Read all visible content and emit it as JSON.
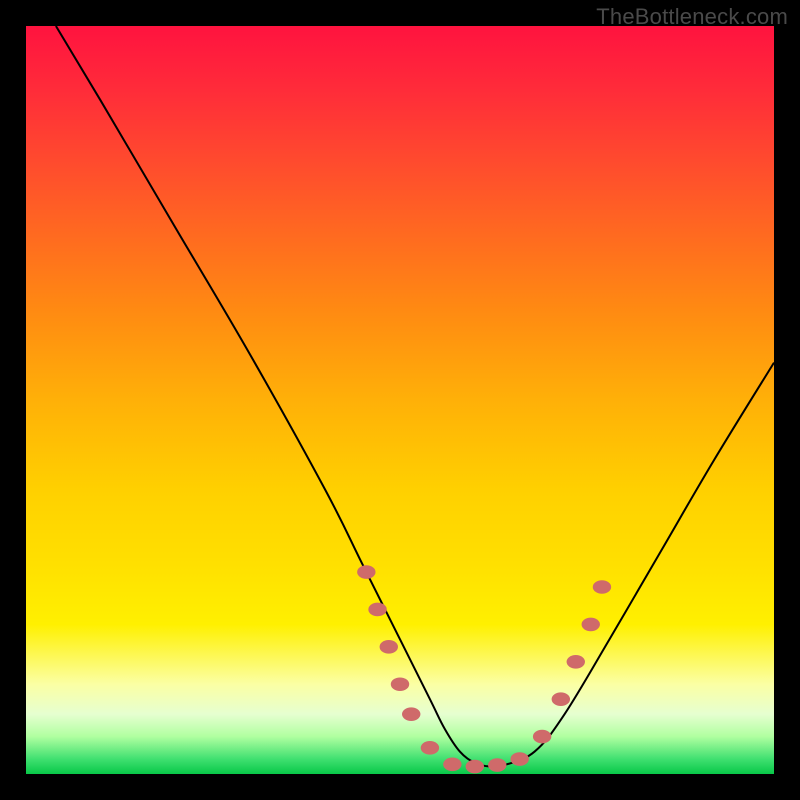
{
  "watermark": "TheBottleneck.com",
  "chart_data": {
    "type": "line",
    "title": "",
    "xlabel": "",
    "ylabel": "",
    "xlim": [
      0,
      100
    ],
    "ylim": [
      0,
      100
    ],
    "grid": false,
    "legend": false,
    "series": [
      {
        "name": "curve",
        "x": [
          4,
          10,
          20,
          30,
          40,
          45,
          50,
          54,
          56,
          58,
          60,
          62,
          64,
          68,
          72,
          78,
          85,
          92,
          100
        ],
        "y": [
          100,
          90,
          73,
          56,
          38,
          28,
          18,
          10,
          6,
          3,
          1.5,
          1,
          1.2,
          3,
          8,
          18,
          30,
          42,
          55
        ],
        "stroke": "#000000",
        "stroke_width": 2
      }
    ],
    "markers": [
      {
        "name": "highlight-dots",
        "color": "#cf6a6a",
        "radius": 8,
        "points": [
          {
            "x": 45.5,
            "y": 27
          },
          {
            "x": 47.0,
            "y": 22
          },
          {
            "x": 48.5,
            "y": 17
          },
          {
            "x": 50.0,
            "y": 12
          },
          {
            "x": 51.5,
            "y": 8
          },
          {
            "x": 54.0,
            "y": 3.5
          },
          {
            "x": 57.0,
            "y": 1.3
          },
          {
            "x": 60.0,
            "y": 1.0
          },
          {
            "x": 63.0,
            "y": 1.2
          },
          {
            "x": 66.0,
            "y": 2.0
          },
          {
            "x": 69.0,
            "y": 5.0
          },
          {
            "x": 71.5,
            "y": 10.0
          },
          {
            "x": 73.5,
            "y": 15.0
          },
          {
            "x": 75.5,
            "y": 20.0
          },
          {
            "x": 77.0,
            "y": 25.0
          }
        ]
      }
    ]
  }
}
